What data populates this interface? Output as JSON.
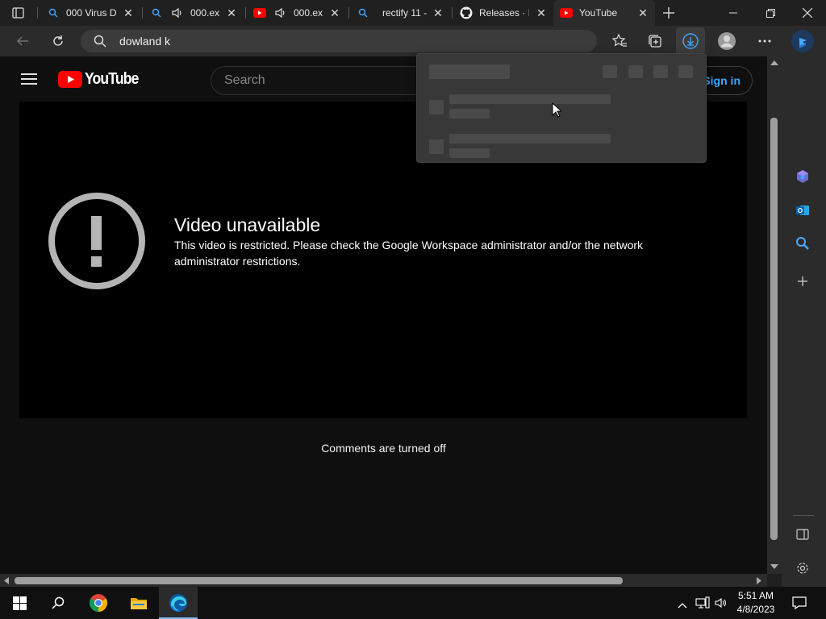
{
  "browser": {
    "tabs": [
      {
        "title": "000 Virus D",
        "icon": "search-icon"
      },
      {
        "title": "000.exe",
        "icon": "search-icon",
        "audio": true
      },
      {
        "title": "000.exe",
        "icon": "youtube-icon",
        "audio": true
      },
      {
        "title": "rectify 11 -",
        "icon": "search-icon"
      },
      {
        "title": "Releases · M",
        "icon": "github-icon"
      },
      {
        "title": "YouTube",
        "icon": "youtube-icon",
        "active": true
      }
    ],
    "address_text": "dowland k"
  },
  "youtube": {
    "logo_text": "YouTube",
    "search_placeholder": "Search",
    "signin_label": "Sign in",
    "error_title": "Video unavailable",
    "error_message": "This video is restricted. Please check the Google Workspace administrator and/or the network administrator restrictions.",
    "comments_text": "Comments are turned off"
  },
  "taskbar": {
    "time": "5:51 AM",
    "date": "4/8/2023"
  },
  "colors": {
    "youtube_red": "#ff0000",
    "link_blue": "#3ea6ff",
    "edge_blue": "#1e88e5"
  }
}
